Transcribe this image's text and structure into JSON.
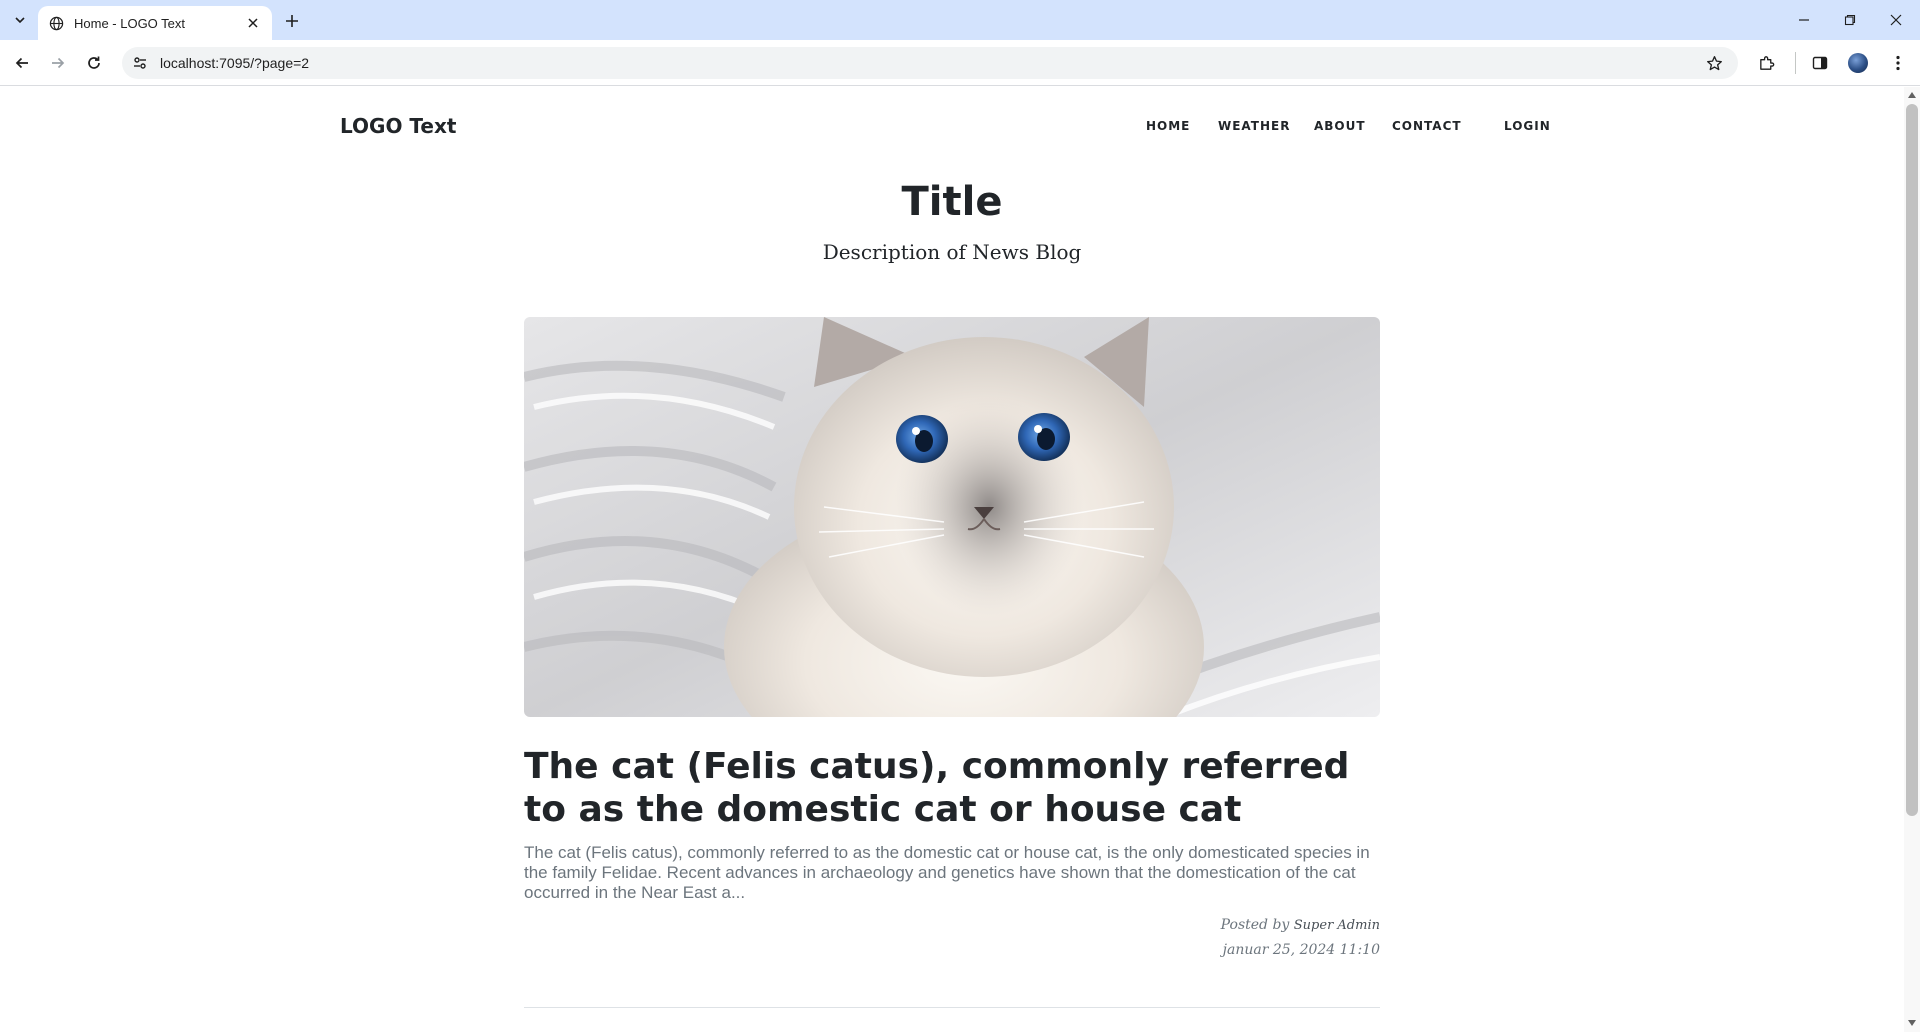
{
  "browser": {
    "tab_title": "Home - LOGO Text",
    "url": "localhost:7095/?page=2"
  },
  "site": {
    "logo": "LOGO Text",
    "nav": [
      "HOME",
      "WEATHER",
      "ABOUT",
      "CONTACT",
      "LOGIN"
    ],
    "title": "Title",
    "subtitle": "Description of News Blog"
  },
  "post": {
    "title": "The cat (Felis catus), commonly referred to as the domestic cat or house cat",
    "excerpt": "The cat (Felis catus), commonly referred to as the domestic cat or house cat, is the only domesticated species in the family Felidae. Recent advances in archaeology and genetics have shown that the domestication of the cat occurred in the Near East a...",
    "posted_by_label": "Posted by",
    "author": "Super Admin",
    "date": "januar 25, 2024 11:10"
  },
  "colors": {
    "tab_strip": "#d3e3fd",
    "text": "#212529",
    "muted": "#6c757d"
  }
}
